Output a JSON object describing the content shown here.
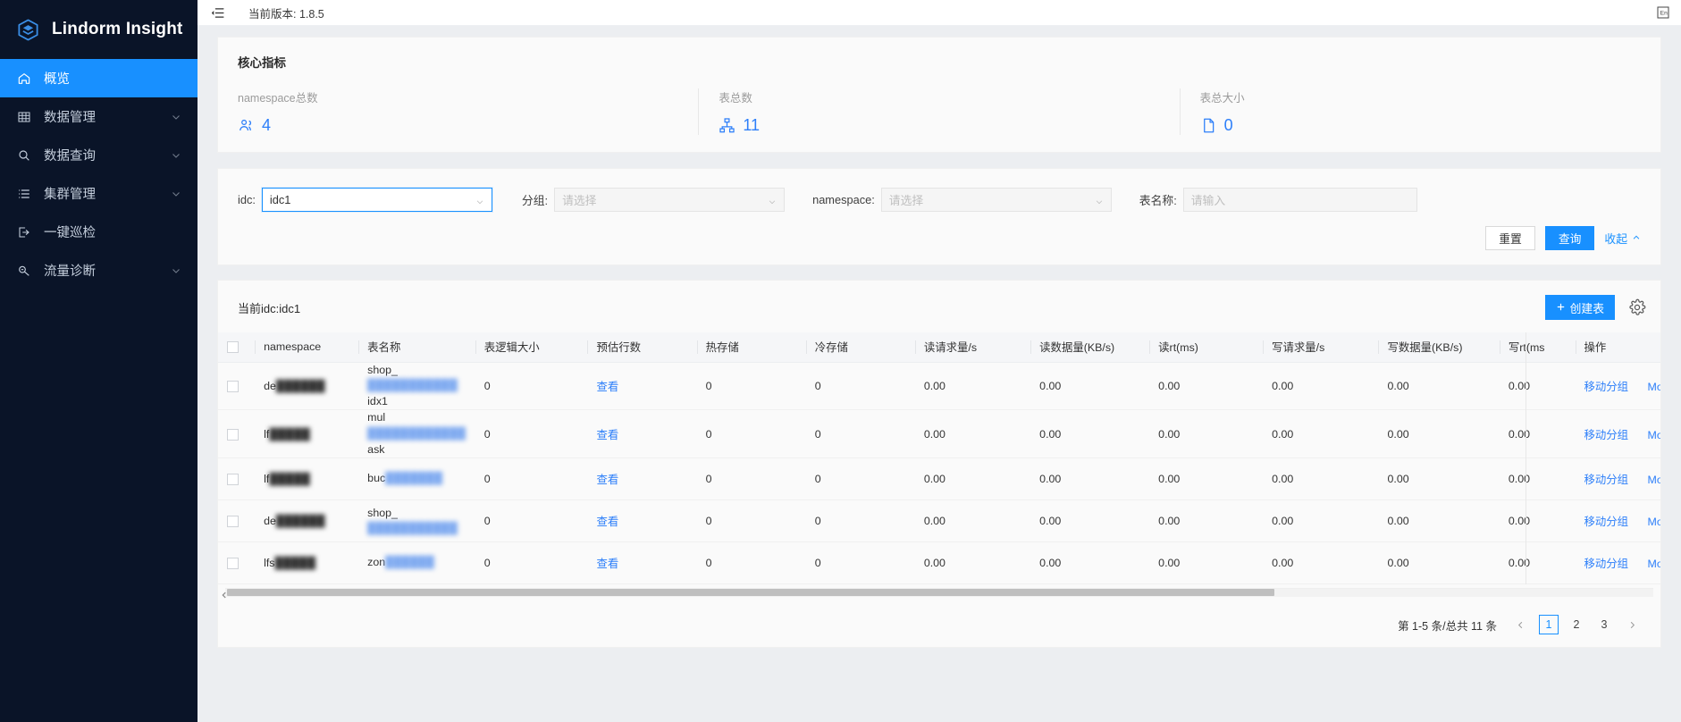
{
  "brand": {
    "title": "Lindorm Insight",
    "logo_icon": "cube-layers-icon"
  },
  "sidebar": {
    "items": [
      {
        "label": "概览",
        "icon": "home-icon",
        "active": true,
        "expandable": false
      },
      {
        "label": "数据管理",
        "icon": "table-grid-icon",
        "active": false,
        "expandable": true
      },
      {
        "label": "数据查询",
        "icon": "search-icon",
        "active": false,
        "expandable": true
      },
      {
        "label": "集群管理",
        "icon": "list-icon",
        "active": false,
        "expandable": true
      },
      {
        "label": "一键巡检",
        "icon": "inspect-export-icon",
        "active": false,
        "expandable": false
      },
      {
        "label": "流量诊断",
        "icon": "diagnosis-icon",
        "active": false,
        "expandable": true
      }
    ]
  },
  "topbar": {
    "collapse_icon": "menu-collapse-icon",
    "version_text": "当前版本: 1.8.5",
    "lang_icon": "language-switch-icon"
  },
  "metrics": {
    "title": "核心指标",
    "items": [
      {
        "label": "namespace总数",
        "value": "4",
        "icon": "namespace-users-icon"
      },
      {
        "label": "表总数",
        "value": "11",
        "icon": "table-tree-icon"
      },
      {
        "label": "表总大小",
        "value": "0",
        "icon": "file-doc-icon"
      }
    ]
  },
  "filters": {
    "idc": {
      "label": "idc:",
      "value": "idc1",
      "placeholder": "",
      "caret_icon": "chevron-down-icon"
    },
    "group": {
      "label": "分组:",
      "value": "",
      "placeholder": "请选择",
      "caret_icon": "chevron-down-icon"
    },
    "namespace": {
      "label": "namespace:",
      "value": "",
      "placeholder": "请选择",
      "caret_icon": "chevron-down-icon"
    },
    "table_name": {
      "label": "表名称:",
      "value": "",
      "placeholder": "请输入"
    },
    "reset_label": "重置",
    "query_label": "查询",
    "collapse_label": "收起",
    "collapse_icon": "chevron-up-icon"
  },
  "table_panel": {
    "title": "当前idc:idc1",
    "create_label": "创建表",
    "create_icon": "plus-icon",
    "settings_icon": "gear-icon",
    "columns": [
      "namespace",
      "表名称",
      "表逻辑大小",
      "预估行数",
      "热存储",
      "冷存储",
      "读请求量/s",
      "读数据量(KB/s)",
      "读rt(ms)",
      "写请求量/s",
      "写数据量(KB/s)",
      "写rt(ms",
      "操作"
    ],
    "view_label": "查看",
    "ops": {
      "move_group": "移动分组",
      "more": "More",
      "more_icon": "chevron-down-icon"
    },
    "rows": [
      {
        "namespace_prefix": "de",
        "namespace_redacted": "██████",
        "table_prefix": "shop_",
        "table_redacted": "███████████",
        "table_suffix": "idx1",
        "logical_size": "0",
        "est_rows_link": "查看",
        "hot": "0",
        "cold": "0",
        "read_req": "0.00",
        "read_data": "0.00",
        "read_rt": "0.00",
        "write_req": "0.00",
        "write_data": "0.00",
        "write_rt": "0.00"
      },
      {
        "namespace_prefix": "lf",
        "namespace_redacted": "█████",
        "table_prefix": "mul",
        "table_redacted": "████████████",
        "table_suffix": "ask",
        "logical_size": "0",
        "est_rows_link": "查看",
        "hot": "0",
        "cold": "0",
        "read_req": "0.00",
        "read_data": "0.00",
        "read_rt": "0.00",
        "write_req": "0.00",
        "write_data": "0.00",
        "write_rt": "0.00"
      },
      {
        "namespace_prefix": "lf",
        "namespace_redacted": "█████",
        "table_prefix": "buc",
        "table_redacted": "███████",
        "table_suffix": "",
        "logical_size": "0",
        "est_rows_link": "查看",
        "hot": "0",
        "cold": "0",
        "read_req": "0.00",
        "read_data": "0.00",
        "read_rt": "0.00",
        "write_req": "0.00",
        "write_data": "0.00",
        "write_rt": "0.00"
      },
      {
        "namespace_prefix": "de",
        "namespace_redacted": "██████",
        "table_prefix": "shop_",
        "table_redacted": "███████████",
        "table_suffix": "",
        "logical_size": "0",
        "est_rows_link": "查看",
        "hot": "0",
        "cold": "0",
        "read_req": "0.00",
        "read_data": "0.00",
        "read_rt": "0.00",
        "write_req": "0.00",
        "write_data": "0.00",
        "write_rt": "0.00"
      },
      {
        "namespace_prefix": "lfs",
        "namespace_redacted": "█████",
        "table_prefix": "zon",
        "table_redacted": "██████",
        "table_suffix": "",
        "logical_size": "0",
        "est_rows_link": "查看",
        "hot": "0",
        "cold": "0",
        "read_req": "0.00",
        "read_data": "0.00",
        "read_rt": "0.00",
        "write_req": "0.00",
        "write_data": "0.00",
        "write_rt": "0.00"
      }
    ]
  },
  "pagination": {
    "summary": "第 1-5 条/总共 11 条",
    "prev_icon": "chevron-left-icon",
    "next_icon": "chevron-right-icon",
    "pages": [
      "1",
      "2",
      "3"
    ],
    "current": "1"
  },
  "colors": {
    "accent": "#1890ff",
    "link": "#2d7ff9",
    "sidebar_bg": "#0a1428",
    "page_bg": "#eceef1",
    "card_bg": "#fafafa"
  }
}
